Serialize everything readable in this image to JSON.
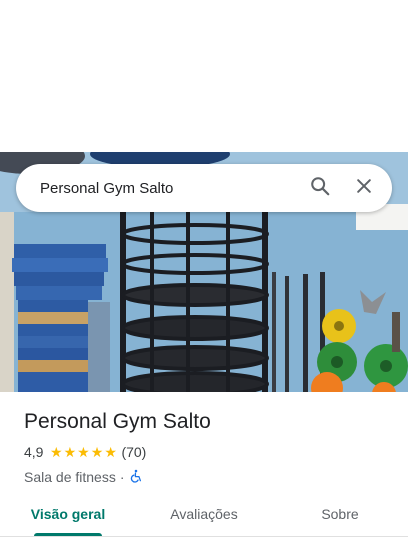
{
  "search": {
    "query": "Personal Gym Salto",
    "search_icon": "search-icon",
    "close_icon": "close-icon"
  },
  "photo": {
    "description_icon": "place-photo"
  },
  "place": {
    "name": "Personal Gym Salto",
    "rating": "4,9",
    "rating_value": 4.9,
    "stars": "★★★★★",
    "reviews": "(70)",
    "category": "Sala de fitness",
    "separator": "·",
    "accessibility_icon": "wheelchair-icon"
  },
  "tabs": [
    {
      "label": "Visão geral",
      "active": true
    },
    {
      "label": "Avaliações",
      "active": false
    },
    {
      "label": "Sobre",
      "active": false
    }
  ],
  "colors": {
    "accent": "#00796b",
    "star": "#fbbc04",
    "accessibility": "#1a73e8"
  }
}
